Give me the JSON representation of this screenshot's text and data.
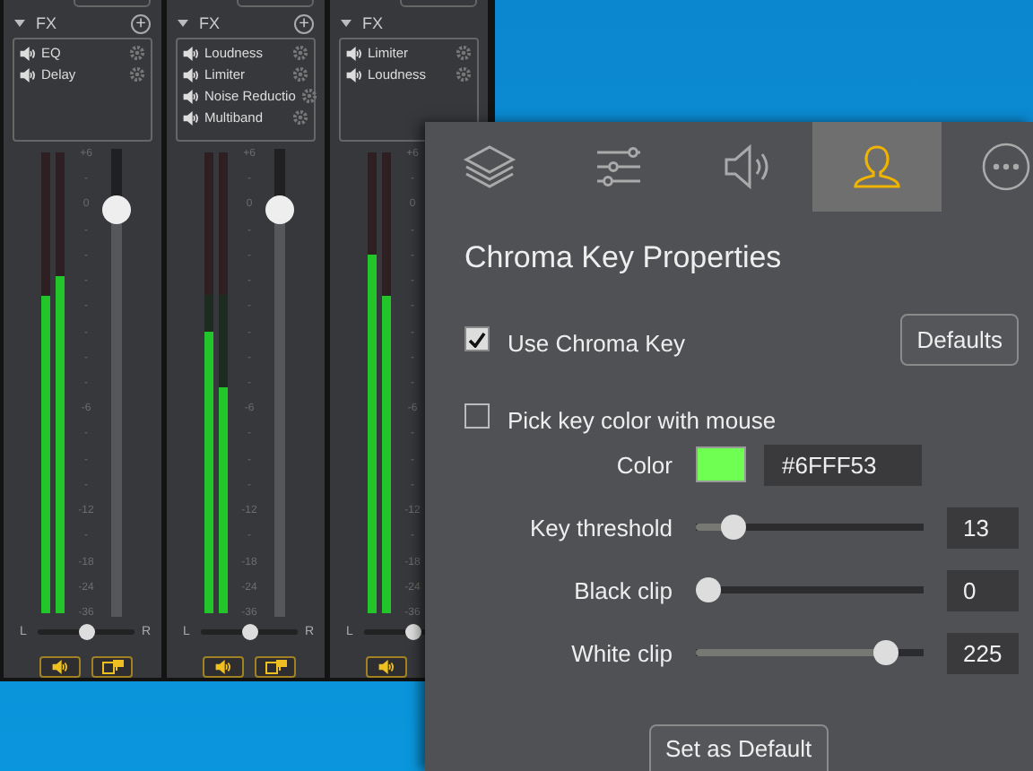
{
  "mixer": {
    "strips": [
      {
        "fx_title": "FX",
        "add": "+",
        "effects": [
          "EQ",
          "Delay"
        ],
        "meters": [
          {
            "level": 0.69
          },
          {
            "level": 0.73
          }
        ],
        "scale": [
          "+6",
          "-",
          "0",
          "-",
          "-",
          "-",
          "-",
          "-",
          "-",
          "-",
          "-6",
          "-",
          "-",
          "-",
          "-12",
          "-",
          "-18",
          "-24",
          "-36"
        ],
        "fader": {
          "level": 0.87
        },
        "pan": {
          "left": "L",
          "right": "R",
          "level": 0.5
        },
        "buttons": [
          {
            "kind": "speaker"
          },
          {
            "kind": "monitor"
          }
        ]
      },
      {
        "fx_title": "FX",
        "add": "+",
        "effects": [
          "Loudness",
          "Limiter",
          "Noise Reductio",
          "Multiband"
        ],
        "meters": [
          {
            "level": 0.61
          },
          {
            "level": 0.49
          }
        ],
        "scale": [
          "+6",
          "-",
          "0",
          "-",
          "-",
          "-",
          "-",
          "-",
          "-",
          "-",
          "-6",
          "-",
          "-",
          "-",
          "-12",
          "-",
          "-18",
          "-24",
          "-36"
        ],
        "fader": {
          "level": 0.87
        },
        "pan": {
          "left": "L",
          "right": "R",
          "level": 0.5
        },
        "buttons": [
          {
            "kind": "speaker"
          },
          {
            "kind": "monitor"
          }
        ]
      },
      {
        "fx_title": "FX",
        "effects": [
          "Limiter",
          "Loudness"
        ],
        "meters": [
          {
            "level": 0.78
          },
          {
            "level": 0.69
          }
        ],
        "scale": [
          "+6",
          "-",
          "0",
          "-",
          "-",
          "-",
          "-",
          "-",
          "-",
          "-",
          "-6",
          "-",
          "-",
          "-",
          "-12",
          "-",
          "-18",
          "-24",
          "-36"
        ],
        "pan": {
          "left": "L",
          "level": 0.5
        },
        "buttons": [
          {
            "kind": "speaker"
          }
        ]
      }
    ]
  },
  "panel": {
    "tabs": [
      {
        "kind": "layers",
        "selected": false
      },
      {
        "kind": "sliders",
        "selected": false
      },
      {
        "kind": "speaker",
        "selected": false
      },
      {
        "kind": "person",
        "selected": true
      },
      {
        "kind": "more",
        "selected": false
      }
    ],
    "title": "Chroma Key Properties",
    "use_chroma_key": {
      "label": "Use Chroma Key",
      "checked": true
    },
    "defaults_button": "Defaults",
    "pick_color": {
      "label": "Pick key color with mouse",
      "checked": false
    },
    "color": {
      "label": "Color",
      "value": "#6FFF53"
    },
    "sliders": [
      {
        "label": "Key threshold",
        "level": 0.12,
        "value": "13"
      },
      {
        "label": "Black clip",
        "level": 0.0,
        "value": "0"
      },
      {
        "label": "White clip",
        "level": 0.88,
        "value": "225"
      }
    ],
    "set_default_button": "Set as Default"
  }
}
